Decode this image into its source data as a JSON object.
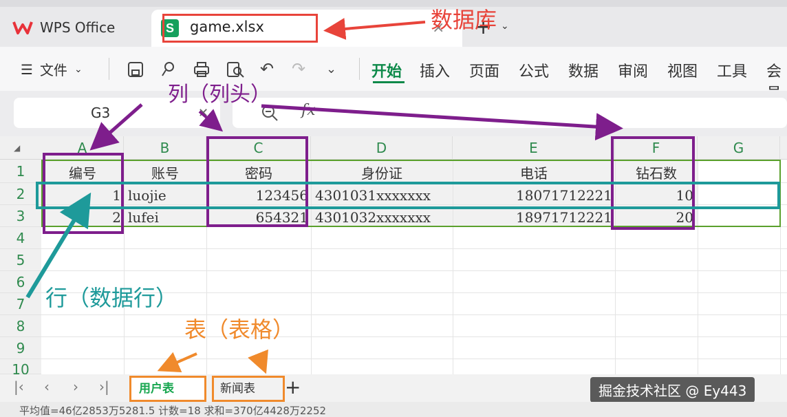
{
  "title_bar": {
    "app_name": "WPS Office",
    "file_tab": {
      "name": "game.xlsx",
      "icon": "S",
      "close": "×"
    },
    "new_tab": "+",
    "more": "⌄"
  },
  "toolbar": {
    "file_menu": "文件",
    "icons": [
      "save-icon",
      "link-icon",
      "print-icon",
      "preview-icon",
      "undo-icon",
      "redo-icon",
      "more-icon"
    ],
    "ribbon_tabs": [
      "开始",
      "插入",
      "页面",
      "公式",
      "数据",
      "审阅",
      "视图",
      "工具",
      "会员"
    ],
    "active_tab": "开始"
  },
  "formula_bar": {
    "cell_ref": "G3",
    "fx_label": "fx",
    "value": ""
  },
  "sheet": {
    "columns": [
      "A",
      "B",
      "C",
      "D",
      "E",
      "F",
      "G"
    ],
    "rows": [
      "1",
      "2",
      "3",
      "4",
      "5",
      "6",
      "7",
      "8",
      "9",
      "10"
    ],
    "header": [
      "编号",
      "账号",
      "密码",
      "身份证",
      "电话",
      "钻石数"
    ],
    "data": [
      [
        "1",
        "luojie",
        "123456",
        "4301031xxxxxxx",
        "18071712221",
        "10"
      ],
      [
        "2",
        "lufei",
        "654321",
        "4301032xxxxxxx",
        "18971712221",
        "20"
      ]
    ]
  },
  "sheet_tabs": {
    "tabs": [
      "用户表",
      "新闻表"
    ],
    "active": "用户表",
    "add": "+"
  },
  "watermark": "掘金技术社区 @ Ey443",
  "status_bar": {
    "text": "平均值=46亿2853万5281.5  计数=18  求和=370亿4428万2252"
  },
  "annotations": {
    "database": "数据库",
    "column": "列（列头）",
    "row": "行（数据行）",
    "table": "表（表格）",
    "colors": {
      "database": "#e8443a",
      "column": "#7e1e8c",
      "row": "#1e9a9a",
      "table": "#f08a2c"
    }
  }
}
